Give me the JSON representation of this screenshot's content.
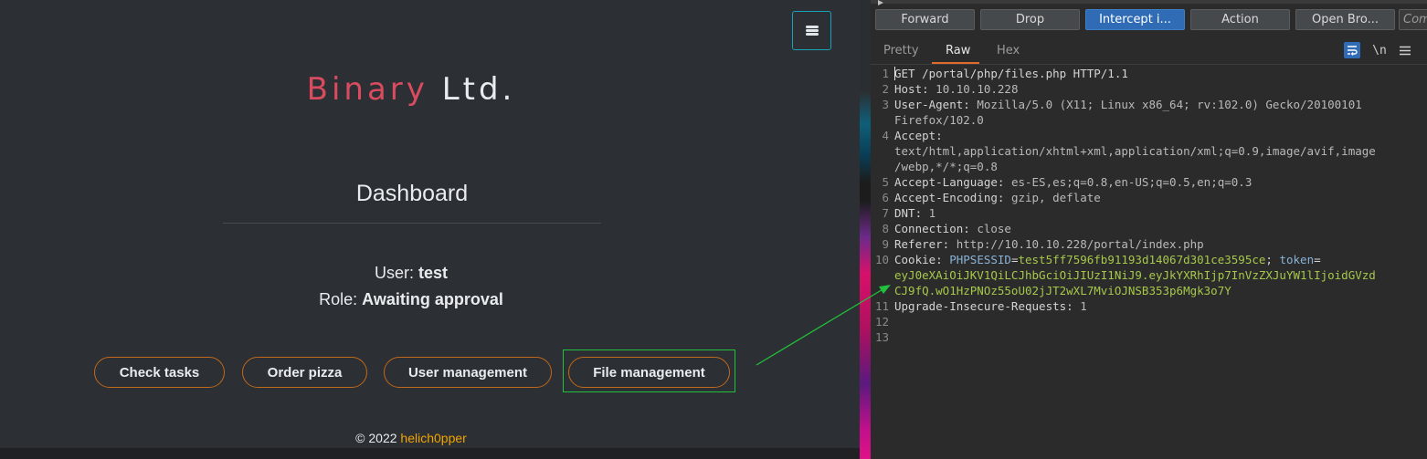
{
  "app": {
    "brand": "Binary",
    "brand_suffix": "Ltd.",
    "page_title": "Dashboard",
    "user_label": "User:",
    "user_value": "test",
    "role_label": "Role:",
    "role_value": "Awaiting approval",
    "nav_buttons": [
      {
        "label": "Check tasks"
      },
      {
        "label": "Order pizza"
      },
      {
        "label": "User management"
      },
      {
        "label": "File management"
      }
    ],
    "footer_prefix": "© 2022",
    "footer_author": "helich0pper",
    "menu_icon": "hamburger-icon"
  },
  "proxy": {
    "toolbar": {
      "forward": "Forward",
      "drop": "Drop",
      "intercept": "Intercept i...",
      "action": "Action",
      "open_browser": "Open Bro...",
      "comment_placeholder": "Comm"
    },
    "tabs": [
      "Pretty",
      "Raw",
      "Hex"
    ],
    "active_tab": "Raw",
    "icons": {
      "wrap": "wrap-lines-icon",
      "newline": "\\n",
      "menu": "menu-icon"
    },
    "line_numbers": [
      "1",
      "2",
      "3",
      "4",
      "5",
      "6",
      "7",
      "8",
      "9",
      "10",
      "11",
      "12",
      "13"
    ],
    "request": {
      "request_line": "GET /portal/php/files.php HTTP/1.1",
      "headers": [
        {
          "name": "Host:",
          "value": " 10.10.10.228"
        },
        {
          "name": "User-Agent:",
          "value": " Mozilla/5.0 (X11; Linux x86_64; rv:102.0) Gecko/20100101",
          "cont": [
            "Firefox/102.0"
          ]
        },
        {
          "name": "Accept:",
          "value": "",
          "cont": [
            "text/html,application/xhtml+xml,application/xml;q=0.9,image/avif,image",
            "/webp,*/*;q=0.8"
          ]
        },
        {
          "name": "Accept-Language:",
          "value": " es-ES,es;q=0.8,en-US;q=0.5,en;q=0.3"
        },
        {
          "name": "Accept-Encoding:",
          "value": " gzip, deflate"
        },
        {
          "name": "DNT:",
          "value": " 1"
        },
        {
          "name": "Connection:",
          "value": " close"
        },
        {
          "name": "Referer:",
          "value": " http://10.10.10.228/portal/index.php"
        }
      ],
      "cookie": {
        "name": "Cookie:",
        "k1": "PHPSESSID",
        "v1": "test5ff7596fb91193d14067d301ce3595ce",
        "sep": "; ",
        "k2": "token",
        "v2_line1": "eyJ0eXAiOiJKV1QiLCJhbGciOiJIUzI1NiJ9.eyJkYXRhIjp7InVzZXJuYW1lIjoidGVzd",
        "v2_line2": "CJ9fQ.wO1HzPNOz55oU02jJT2wXL7MviOJNSB353p6Mgk3o7Y"
      },
      "last_header": {
        "name": "Upgrade-Insecure-Requests:",
        "value": " 1"
      }
    }
  },
  "colors": {
    "brand_red": "#d94b5f",
    "button_border": "#c0691a",
    "highlight_green": "#22c03c",
    "intercept_blue": "#2f6cb5",
    "raw_underline": "#e06b2a",
    "footer_author": "#f0a500"
  }
}
